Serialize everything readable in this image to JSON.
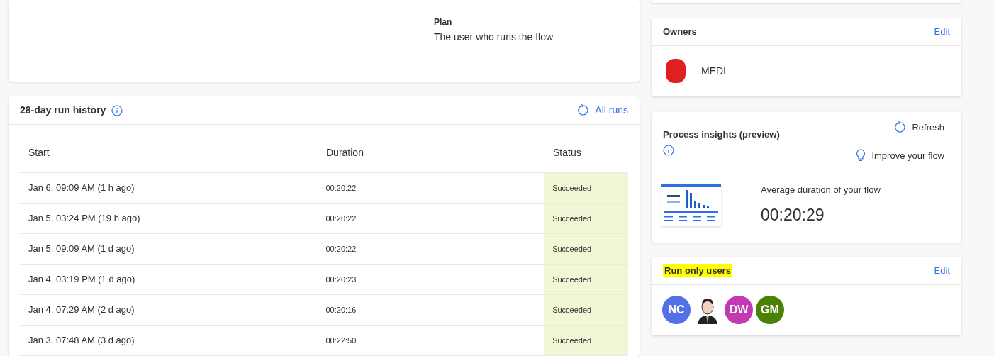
{
  "details": {
    "label": "Plan",
    "value": "The user who runs the flow"
  },
  "run_history": {
    "title": "28-day run history",
    "all_runs": "All runs",
    "columns": [
      "Start",
      "Duration",
      "Status"
    ],
    "rows": [
      {
        "start": "Jan 6, 09:09 AM (1 h ago)",
        "duration": "00:20:22",
        "status": "Succeeded",
        "kind": "success"
      },
      {
        "start": "Jan 5, 03:24 PM (19 h ago)",
        "duration": "00:20:22",
        "status": "Succeeded",
        "kind": "success"
      },
      {
        "start": "Jan 5, 09:09 AM (1 d ago)",
        "duration": "00:20:22",
        "status": "Succeeded",
        "kind": "success"
      },
      {
        "start": "Jan 4, 03:19 PM (1 d ago)",
        "duration": "00:20:23",
        "status": "Succeeded",
        "kind": "success"
      },
      {
        "start": "Jan 4, 07:29 AM (2 d ago)",
        "duration": "00:20:16",
        "status": "Succeeded",
        "kind": "success"
      },
      {
        "start": "Jan 3, 07:48 AM (3 d ago)",
        "duration": "00:22:50",
        "status": "Succeeded",
        "kind": "success"
      }
    ]
  },
  "owners": {
    "title": "Owners",
    "edit": "Edit",
    "items": [
      {
        "name": "MEDI"
      }
    ]
  },
  "process_insights": {
    "title": "Process insights (preview)",
    "refresh": "Refresh",
    "improve": "Improve your flow",
    "metric_label": "Average duration of your flow",
    "metric_value": "00:20:29"
  },
  "run_only_users": {
    "title": "Run only users",
    "highlighted": true,
    "edit": "Edit",
    "users": [
      {
        "kind": "initials",
        "initials": "NC",
        "color": "#5470e8"
      },
      {
        "kind": "picture"
      },
      {
        "kind": "initials",
        "initials": "DW",
        "color": "#c239b3"
      },
      {
        "kind": "initials",
        "initials": "GM",
        "color": "#498205"
      }
    ]
  }
}
